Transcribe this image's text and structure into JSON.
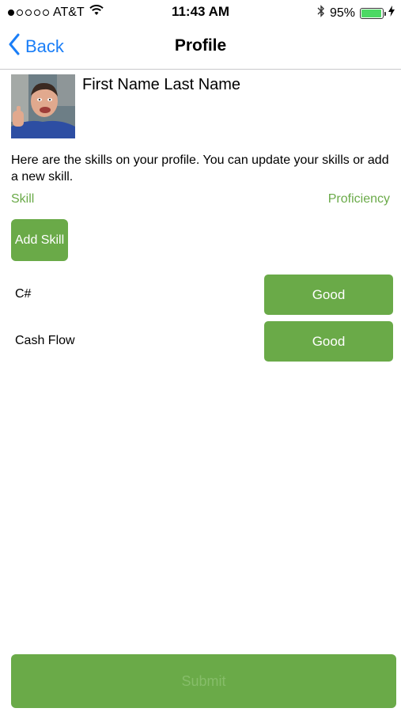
{
  "status_bar": {
    "carrier": "AT&T",
    "time": "11:43 AM",
    "battery": "95%",
    "battery_level": 0.95,
    "icons": [
      "signal-dots-icon",
      "wifi-icon",
      "bluetooth-icon",
      "battery-icon",
      "charging-bolt-icon"
    ]
  },
  "nav": {
    "back_label": "Back",
    "title": "Profile"
  },
  "profile": {
    "name": "First Name Last Name",
    "intro": "Here are the skills on your profile. You can update your skills or add a new skill."
  },
  "columns": {
    "skill": "Skill",
    "proficiency": "Proficiency"
  },
  "add_skill_label": "Add Skill",
  "skills": [
    {
      "name": "C#",
      "proficiency": "Good"
    },
    {
      "name": "Cash Flow",
      "proficiency": "Good"
    }
  ],
  "submit_label": "Submit",
  "colors": {
    "accent_green": "#6aaa48",
    "ios_blue": "#1a7ef7"
  }
}
